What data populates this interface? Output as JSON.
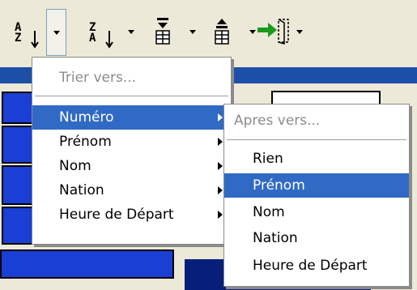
{
  "toolbar": {
    "buttons": [
      {
        "name": "sort-ascending",
        "top": "A",
        "bottom": "Z",
        "icon": "sort-ascending-icon"
      },
      {
        "name": "sort-descending",
        "top": "Z",
        "bottom": "A",
        "icon": "sort-descending-icon"
      },
      {
        "name": "move-to-bottom",
        "icon": "move-down-icon"
      },
      {
        "name": "move-to-top",
        "icon": "move-up-icon"
      },
      {
        "name": "export",
        "icon": "export-door-icon"
      }
    ]
  },
  "menu_main": {
    "header": "Trier vers...",
    "items": [
      "Numéro",
      "Prénom",
      "Nom",
      "Nation",
      "Heure de Départ"
    ],
    "selected_index": 0
  },
  "menu_sub": {
    "header": "Apres vers...",
    "items": [
      "Rien",
      "Prénom",
      "Nom",
      "Nation",
      "Heure de Départ"
    ],
    "selected_index": 1
  },
  "colors": {
    "menu_highlight": "#316ac5",
    "grid_blue": "#1a3fd4",
    "header_band": "#1c50a8",
    "toolbar_bg": "#ece9d8"
  }
}
